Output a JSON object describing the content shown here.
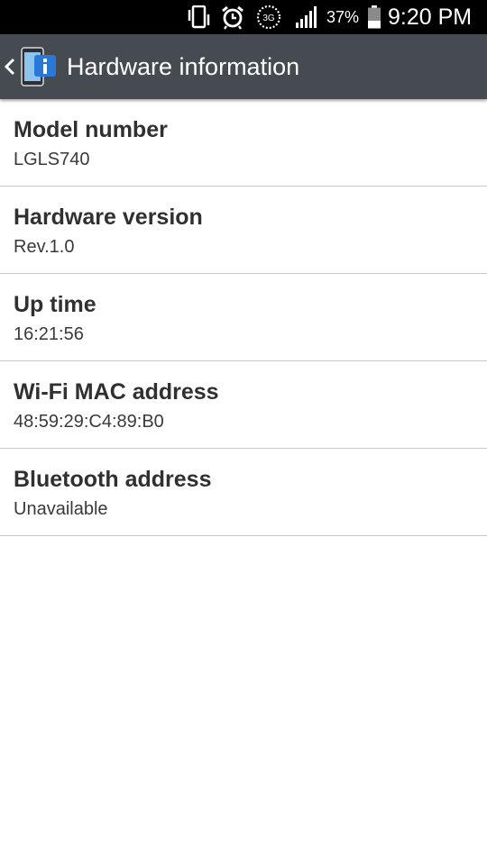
{
  "status_bar": {
    "icons": [
      "vibrate-icon",
      "alarm-icon",
      "3g-icon",
      "signal-icon",
      "battery-icon"
    ],
    "network_label": "3G",
    "battery_percent": "37%",
    "battery_level": 0.37,
    "time": "9:20 PM"
  },
  "action_bar": {
    "title": "Hardware information",
    "icon": "hardware-info-icon",
    "back_icon": "back-chevron-icon"
  },
  "items": [
    {
      "label": "Model number",
      "value": "LGLS740"
    },
    {
      "label": "Hardware version",
      "value": "Rev.1.0"
    },
    {
      "label": "Up time",
      "value": "16:21:56"
    },
    {
      "label": "Wi-Fi MAC address",
      "value": "48:59:29:C4:89:B0"
    },
    {
      "label": "Bluetooth address",
      "value": "Unavailable"
    }
  ],
  "colors": {
    "status_bar_bg": "#000000",
    "action_bar_bg": "#464b52",
    "divider": "#c8c8c8",
    "label_text": "#303030"
  }
}
